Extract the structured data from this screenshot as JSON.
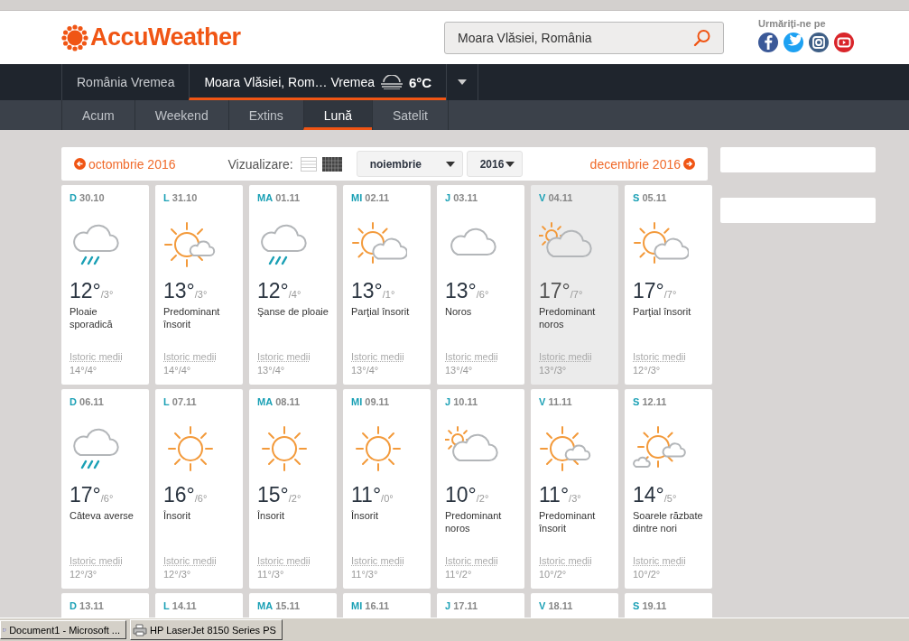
{
  "header": {
    "logo": "AccuWeather",
    "search": {
      "value": "Moara Vlăsiei, România"
    },
    "follow_label": "Urmăriți-ne pe",
    "social": [
      {
        "kind": "f",
        "color": "#3b5998"
      },
      {
        "kind": "bird",
        "color": "#1da1f2"
      },
      {
        "kind": "camera",
        "color": "#3f5f86"
      },
      {
        "kind": "play",
        "color": "#d9252a"
      }
    ]
  },
  "nav": {
    "items": [
      {
        "label": "România Vremea",
        "selected": false
      },
      {
        "label": "Moara Vlăsiei, Rom… Vremea",
        "selected": true,
        "temp": "6°C"
      }
    ]
  },
  "subnav": [
    {
      "label": "Acum",
      "selected": false
    },
    {
      "label": "Weekend",
      "selected": false
    },
    {
      "label": "Extins",
      "selected": false
    },
    {
      "label": "Lună",
      "selected": true
    },
    {
      "label": "Satelit",
      "selected": false
    }
  ],
  "month_bar": {
    "prev": "octombrie 2016",
    "view_label": "Vizualizare:",
    "views": [
      {
        "kind": "list",
        "selected": false
      },
      {
        "kind": "grid",
        "selected": true
      }
    ],
    "month": "noiembrie",
    "year": "2016",
    "next": "decembrie 2016"
  },
  "weeks": [
    [
      {
        "day": "D",
        "date": "30.10",
        "kind": "rain",
        "hi": "12°",
        "lo": "/3°",
        "desc": "Ploaie sporadică",
        "hist": "Istoric medii",
        "hist_value": "14°/4°",
        "highlighted": false
      },
      {
        "day": "L",
        "date": "31.10",
        "kind": "mostly_sunny",
        "hi": "13°",
        "lo": "/3°",
        "desc": "Predominant însorit",
        "hist": "Istoric medii",
        "hist_value": "14°/4°",
        "highlighted": false
      },
      {
        "day": "MA",
        "date": "01.11",
        "kind": "rain",
        "hi": "12°",
        "lo": "/4°",
        "desc": "Şanse de ploaie",
        "hist": "Istoric medii",
        "hist_value": "13°/4°",
        "highlighted": false
      },
      {
        "day": "MI",
        "date": "02.11",
        "kind": "partly_sunny",
        "hi": "13°",
        "lo": "/1°",
        "desc": "Parţial însorit",
        "hist": "Istoric medii",
        "hist_value": "13°/4°",
        "highlighted": false
      },
      {
        "day": "J",
        "date": "03.11",
        "kind": "cloudy",
        "hi": "13°",
        "lo": "/6°",
        "desc": "Noros",
        "hist": "Istoric medii",
        "hist_value": "13°/4°",
        "highlighted": false
      },
      {
        "day": "V",
        "date": "04.11",
        "kind": "mostly_cloudy",
        "hi": "17°",
        "lo": "/7°",
        "desc": "Predominant noros",
        "hist": "Istoric medii",
        "hist_value": "13°/3°",
        "highlighted": true
      },
      {
        "day": "S",
        "date": "05.11",
        "kind": "partly_sunny",
        "hi": "17°",
        "lo": "/7°",
        "desc": "Parţial însorit",
        "hist": "Istoric medii",
        "hist_value": "12°/3°",
        "highlighted": false
      }
    ],
    [
      {
        "day": "D",
        "date": "06.11",
        "kind": "rain",
        "hi": "17°",
        "lo": "/6°",
        "desc": "Câteva averse",
        "hist": "Istoric medii",
        "hist_value": "12°/3°",
        "highlighted": false
      },
      {
        "day": "L",
        "date": "07.11",
        "kind": "sunny",
        "hi": "16°",
        "lo": "/6°",
        "desc": "Însorit",
        "hist": "Istoric medii",
        "hist_value": "12°/3°",
        "highlighted": false
      },
      {
        "day": "MA",
        "date": "08.11",
        "kind": "sunny",
        "hi": "15°",
        "lo": "/2°",
        "desc": "Însorit",
        "hist": "Istoric medii",
        "hist_value": "11°/3°",
        "highlighted": false
      },
      {
        "day": "MI",
        "date": "09.11",
        "kind": "sunny",
        "hi": "11°",
        "lo": "/0°",
        "desc": "Însorit",
        "hist": "Istoric medii",
        "hist_value": "11°/3°",
        "highlighted": false
      },
      {
        "day": "J",
        "date": "10.11",
        "kind": "mostly_cloudy",
        "hi": "10°",
        "lo": "/2°",
        "desc": "Predominant noros",
        "hist": "Istoric medii",
        "hist_value": "11°/2°",
        "highlighted": false
      },
      {
        "day": "V",
        "date": "11.11",
        "kind": "mostly_sunny",
        "hi": "11°",
        "lo": "/3°",
        "desc": "Predominant însorit",
        "hist": "Istoric medii",
        "hist_value": "10°/2°",
        "highlighted": false
      },
      {
        "day": "S",
        "date": "12.11",
        "kind": "sun_clouds",
        "hi": "14°",
        "lo": "/5°",
        "desc": "Soarele răzbate dintre nori",
        "hist": "Istoric medii",
        "hist_value": "10°/2°",
        "highlighted": false
      }
    ],
    [
      {
        "day": "D",
        "date": "13.11",
        "highlighted": false
      },
      {
        "day": "L",
        "date": "14.11",
        "highlighted": false
      },
      {
        "day": "MA",
        "date": "15.11",
        "highlighted": false
      },
      {
        "day": "MI",
        "date": "16.11",
        "highlighted": false
      },
      {
        "day": "J",
        "date": "17.11",
        "highlighted": false
      },
      {
        "day": "V",
        "date": "18.11",
        "highlighted": false
      },
      {
        "day": "S",
        "date": "19.11",
        "highlighted": false
      }
    ]
  ],
  "taskbar": [
    {
      "label": "Document1 - Microsoft ...",
      "kind": "document"
    },
    {
      "label": "HP LaserJet 8150 Series PS",
      "kind": "printer"
    }
  ]
}
